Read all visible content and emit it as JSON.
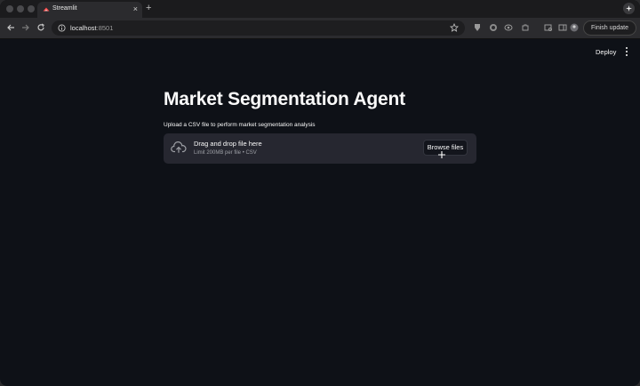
{
  "browser": {
    "tab_title": "Streamlit",
    "url_host": "localhost",
    "url_port": ":8501",
    "finish_update": "Finish update",
    "new_tab_icon": "plus-icon",
    "close_tab_icon": "close-icon"
  },
  "app": {
    "deploy_label": "Deploy",
    "title": "Market Segmentation Agent",
    "upload_label": "Upload a CSV file to perform market segmentation analysis",
    "dropzone": {
      "title": "Drag and drop file here",
      "limit": "Limit 200MB per file • CSV",
      "browse_label": "Browse files",
      "icon": "cloud-upload-icon"
    }
  },
  "colors": {
    "app_background": "#0e1117",
    "dropzone_background": "#262730",
    "text": "#fafafa",
    "muted_text": "#9ea0a6"
  }
}
